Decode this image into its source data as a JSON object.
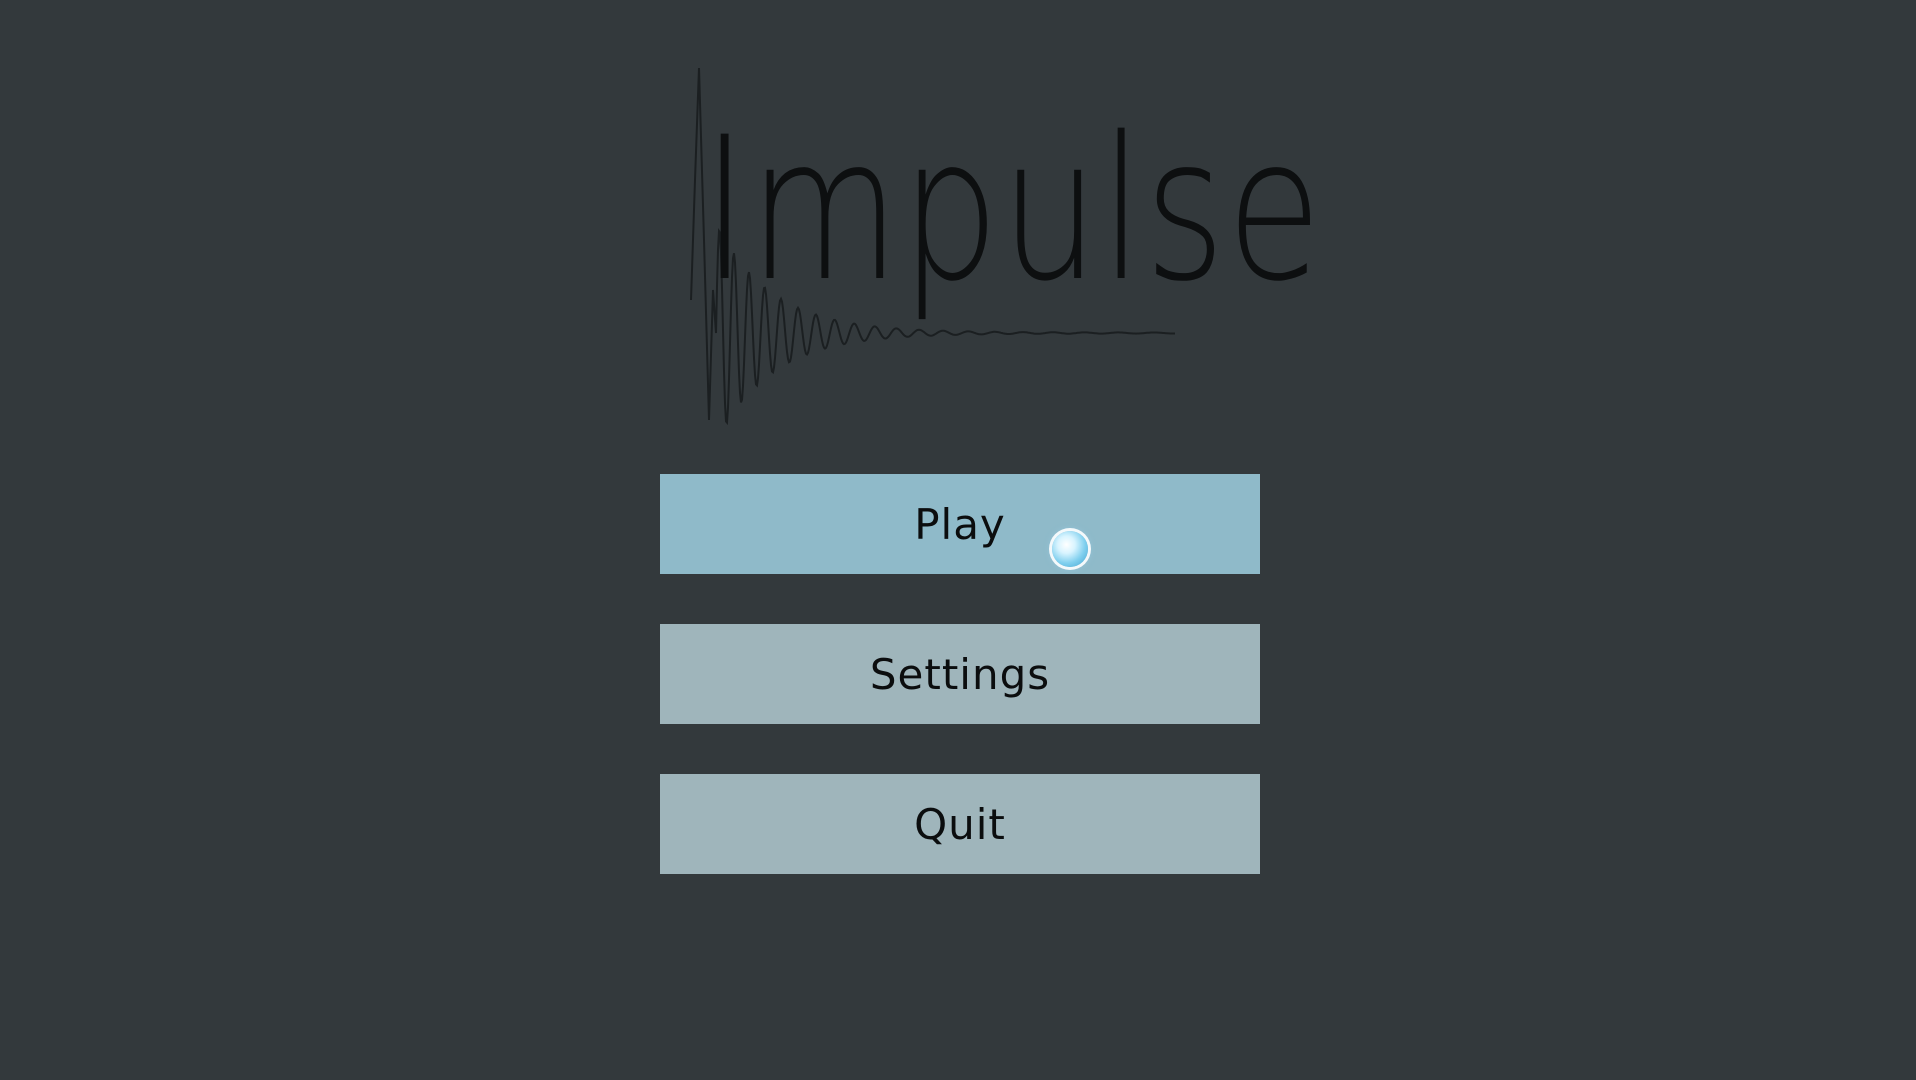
{
  "game": {
    "title": "Impulse"
  },
  "menu": {
    "items": [
      {
        "label": "Play",
        "state": "hover"
      },
      {
        "label": "Settings",
        "state": "normal"
      },
      {
        "label": "Quit",
        "state": "normal"
      }
    ]
  },
  "colors": {
    "background": "#33393c",
    "button": "#9fb5bb",
    "button_hover": "#8fbac9",
    "text": "#0b0d0e",
    "waveform": "#1b1f21"
  },
  "icons": {
    "logo_waveform": "decaying-impulse-waveform",
    "cursor": "glowing-orb-cursor"
  }
}
